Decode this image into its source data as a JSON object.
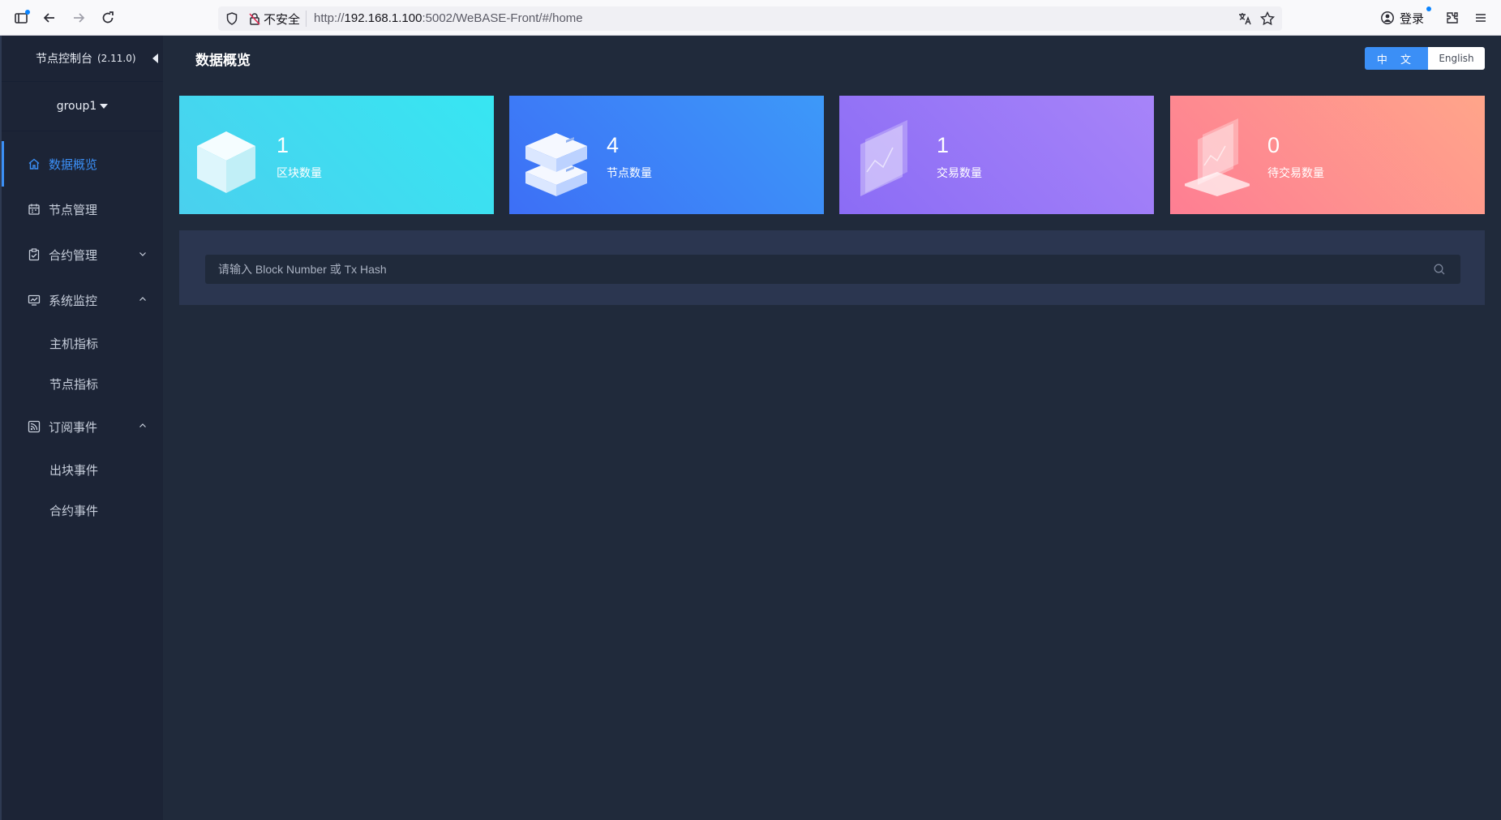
{
  "browser": {
    "insecure_label": "不安全",
    "url_prefix": "http://",
    "url_host": "192.168.1.100",
    "url_rest": ":5002/WeBASE-Front/#/home",
    "login_label": "登录"
  },
  "sidebar": {
    "app_title": "节点控制台",
    "version": "(2.11.0)",
    "group": "group1",
    "menu": {
      "overview": "数据概览",
      "node_mgmt": "节点管理",
      "contract_mgmt": "合约管理",
      "sys_monitor": "系统监控",
      "host_metrics": "主机指标",
      "node_metrics": "节点指标",
      "subscribe": "订阅事件",
      "block_event": "出块事件",
      "contract_event": "合约事件"
    }
  },
  "main": {
    "title": "数据概览",
    "lang_zh": "中 文",
    "lang_en": "English",
    "cards": [
      {
        "value": "1",
        "label": "区块数量"
      },
      {
        "value": "4",
        "label": "节点数量"
      },
      {
        "value": "1",
        "label": "交易数量"
      },
      {
        "value": "0",
        "label": "待交易数量"
      }
    ],
    "search_placeholder": "请输入 Block Number 或 Tx Hash"
  },
  "colors": {
    "accent": "#3b8ff6",
    "sidebar_bg": "#1c2436",
    "main_bg": "#202a3b"
  }
}
